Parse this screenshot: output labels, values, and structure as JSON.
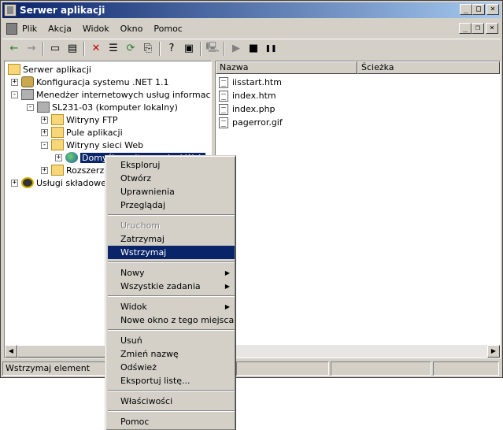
{
  "window": {
    "title": "Serwer aplikacji"
  },
  "menubar": {
    "items": [
      "Plik",
      "Akcja",
      "Widok",
      "Okno",
      "Pomoc"
    ]
  },
  "title_buttons": {
    "minimize": "_",
    "maximize": "□",
    "close": "×"
  },
  "mdi_buttons": {
    "minimize": "_",
    "restore": "❐",
    "close": "×"
  },
  "toolbar": {
    "back": "←",
    "forward": "→",
    "up": "▭",
    "tree": "▤",
    "delete": "✕",
    "properties": "☰",
    "refresh": "⟳",
    "export": "⎘",
    "help": "?",
    "view": "▣",
    "connect": "🖳",
    "play": "▶",
    "stop": "■",
    "pause": "❚❚"
  },
  "tree": {
    "root": "Serwer aplikacji",
    "net": "Konfiguracja systemu .NET 1.1",
    "iis": "Menedżer internetowych usług informacyjnych",
    "server": "SL231-03 (komputer lokalny)",
    "ftp": "Witryny FTP",
    "pools": "Pule aplikacji",
    "web": "Witryny sieci Web",
    "default": "Domyślna witryna sieci Web",
    "ext": "Rozszerzenia usługi sieci Web",
    "com": "Usługi składowe"
  },
  "list": {
    "columns": [
      "Nazwa",
      "Ścieżka"
    ],
    "files": [
      "iisstart.htm",
      "index.htm",
      "index.php",
      "pagerror.gif"
    ]
  },
  "statusbar": {
    "text": "Wstrzymaj element"
  },
  "context_menu": {
    "explore": "Eksploruj",
    "open": "Otwórz",
    "permissions": "Uprawnienia",
    "browse": "Przeglądaj",
    "start": "Uruchom",
    "stop": "Zatrzymaj",
    "pause": "Wstrzymaj",
    "new": "Nowy",
    "all_tasks": "Wszystkie zadania",
    "view": "Widok",
    "new_window": "Nowe okno z tego miejsca",
    "delete": "Usuń",
    "rename": "Zmień nazwę",
    "refresh": "Odśwież",
    "export": "Eksportuj listę...",
    "properties": "Właściwości",
    "help": "Pomoc",
    "submenu_arrow": "▶"
  }
}
